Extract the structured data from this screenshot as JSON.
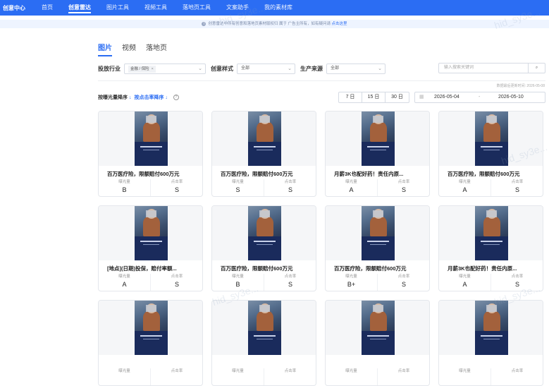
{
  "nav": {
    "brand": "创意中心",
    "items": [
      "首页",
      "创意雷达",
      "图片工具",
      "视频工具",
      "落地页工具",
      "文案助手",
      "我的素材库"
    ],
    "active_index": 1
  },
  "notice": {
    "text": "创意雷达中所有创意和落地页素材版权归 属于 广告主所有，如有疑问请",
    "link": "点击这里"
  },
  "tabs": [
    "图片",
    "视频",
    "落地页"
  ],
  "filters": {
    "industry_label": "投放行业",
    "industry_tag": "金融 / 保险",
    "style_label": "创意样式",
    "style_value": "全部",
    "source_label": "生产来源",
    "source_value": "全部",
    "search_placeholder": "输入搜索关键词"
  },
  "updated_text": "数据最后更新时间: 2026-05-08",
  "sort": {
    "exposure": "按曝光量降序",
    "ctr": "按点击率降序",
    "help": "?"
  },
  "day_buttons": [
    "7 日",
    "15 日",
    "30 日"
  ],
  "date_range": {
    "start": "2026-05-04",
    "sep": "-",
    "end": "2026-05-10"
  },
  "labels": {
    "exposure": "曝光量",
    "ctr": "点击率"
  },
  "cards": [
    {
      "title": "百万医疗险，限额赔付600万元",
      "exposure": "B",
      "ctr": "S"
    },
    {
      "title": "百万医疗险，限额赔付600万元",
      "exposure": "S",
      "ctr": "S"
    },
    {
      "title": "月薪3K也配好药！责任内原...",
      "exposure": "A",
      "ctr": "S"
    },
    {
      "title": "百万医疗险，限额赔付600万元",
      "exposure": "A",
      "ctr": "S"
    },
    {
      "title": "[地点](日期)投保，赔付率额...",
      "exposure": "A",
      "ctr": "S"
    },
    {
      "title": "百万医疗险，限额赔付600万元",
      "exposure": "B",
      "ctr": "S"
    },
    {
      "title": "百万医疗险，限额赔付600万元",
      "exposure": "B+",
      "ctr": "S"
    },
    {
      "title": "月薪3K也配好药！责任内原...",
      "exposure": "A",
      "ctr": "S"
    },
    {
      "title": "",
      "exposure": "",
      "ctr": ""
    },
    {
      "title": "",
      "exposure": "",
      "ctr": ""
    },
    {
      "title": "",
      "exposure": "",
      "ctr": ""
    },
    {
      "title": "",
      "exposure": "",
      "ctr": ""
    }
  ],
  "watermark": "hid_sy3e..."
}
